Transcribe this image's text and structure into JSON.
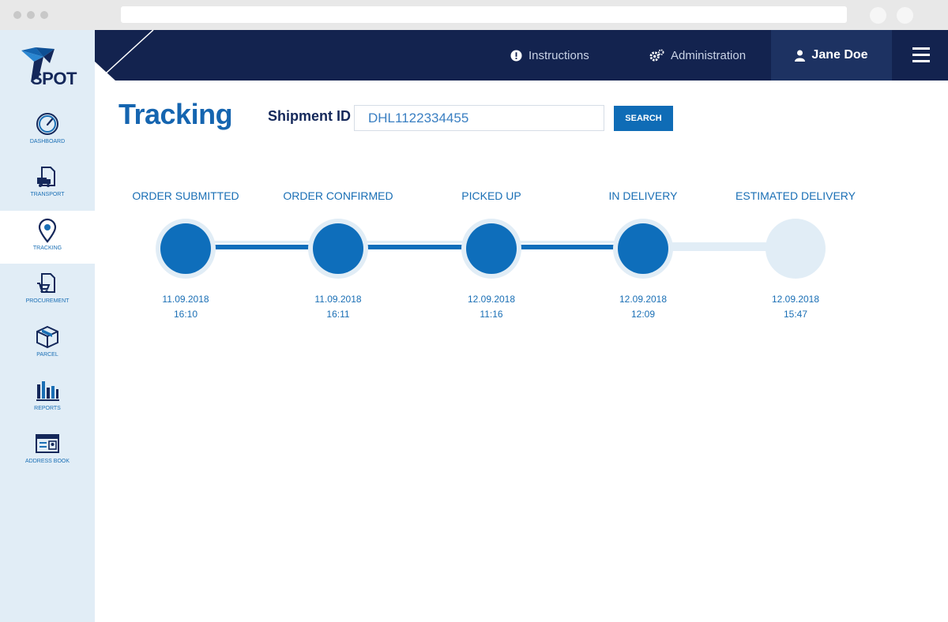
{
  "brand": {
    "logo_text": "SPOT"
  },
  "colors": {
    "navy": "#13234f",
    "accent": "#0e6ebb",
    "light": "#e1edf6"
  },
  "sidebar": {
    "items": [
      {
        "label": "DASHBOARD",
        "icon": "gauge-icon",
        "active": false
      },
      {
        "label": "TRANSPORT",
        "icon": "truck-document-icon",
        "active": false
      },
      {
        "label": "TRACKING",
        "icon": "location-pin-icon",
        "active": true
      },
      {
        "label": "PROCUREMENT",
        "icon": "cart-document-icon",
        "active": false
      },
      {
        "label": "PARCEL",
        "icon": "box-icon",
        "active": false
      },
      {
        "label": "REPORTS",
        "icon": "bar-chart-icon",
        "active": false
      },
      {
        "label": "ADDRESS BOOK",
        "icon": "address-card-icon",
        "active": false
      }
    ]
  },
  "header": {
    "instructions": "Instructions",
    "administration": "Administration",
    "user_name": "Jane Doe"
  },
  "main": {
    "title": "Tracking",
    "shipment_label": "Shipment ID",
    "shipment_value": "DHL1122334455",
    "search_label": "SEARCH"
  },
  "timeline": {
    "steps": [
      {
        "label": "ORDER SUBMITTED",
        "date": "11.09.2018",
        "time": "16:10",
        "completed": true
      },
      {
        "label": "ORDER CONFIRMED",
        "date": "11.09.2018",
        "time": "16:11",
        "completed": true
      },
      {
        "label": "PICKED UP",
        "date": "12.09.2018",
        "time": "11:16",
        "completed": true
      },
      {
        "label": "IN DELIVERY",
        "date": "12.09.2018",
        "time": "12:09",
        "completed": true
      },
      {
        "label": "ESTIMATED DELIVERY",
        "date": "12.09.2018",
        "time": "15:47",
        "completed": false
      }
    ]
  }
}
